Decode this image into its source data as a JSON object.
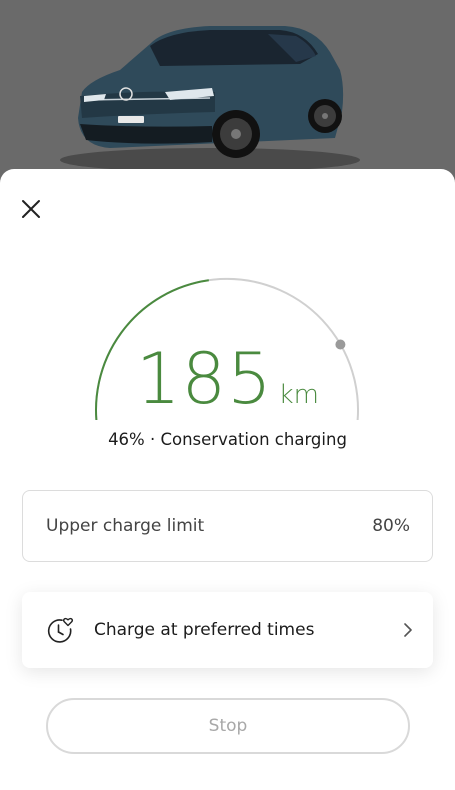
{
  "vehicle": {
    "image": "car-image"
  },
  "charging": {
    "range_value": "185",
    "range_unit": "km",
    "state_of_charge_percent": 46,
    "status_text": "46% · Conservation charging",
    "colors": {
      "accent": "#4a8a3f",
      "track": "#d0d0d0",
      "marker": "#9a9a9a"
    }
  },
  "settings": {
    "upper_limit_label": "Upper charge limit",
    "upper_limit_value": "80%",
    "preferred_times_label": "Charge at preferred times",
    "preferred_times_icon": "clock-heart-icon"
  },
  "actions": {
    "stop_label": "Stop"
  }
}
